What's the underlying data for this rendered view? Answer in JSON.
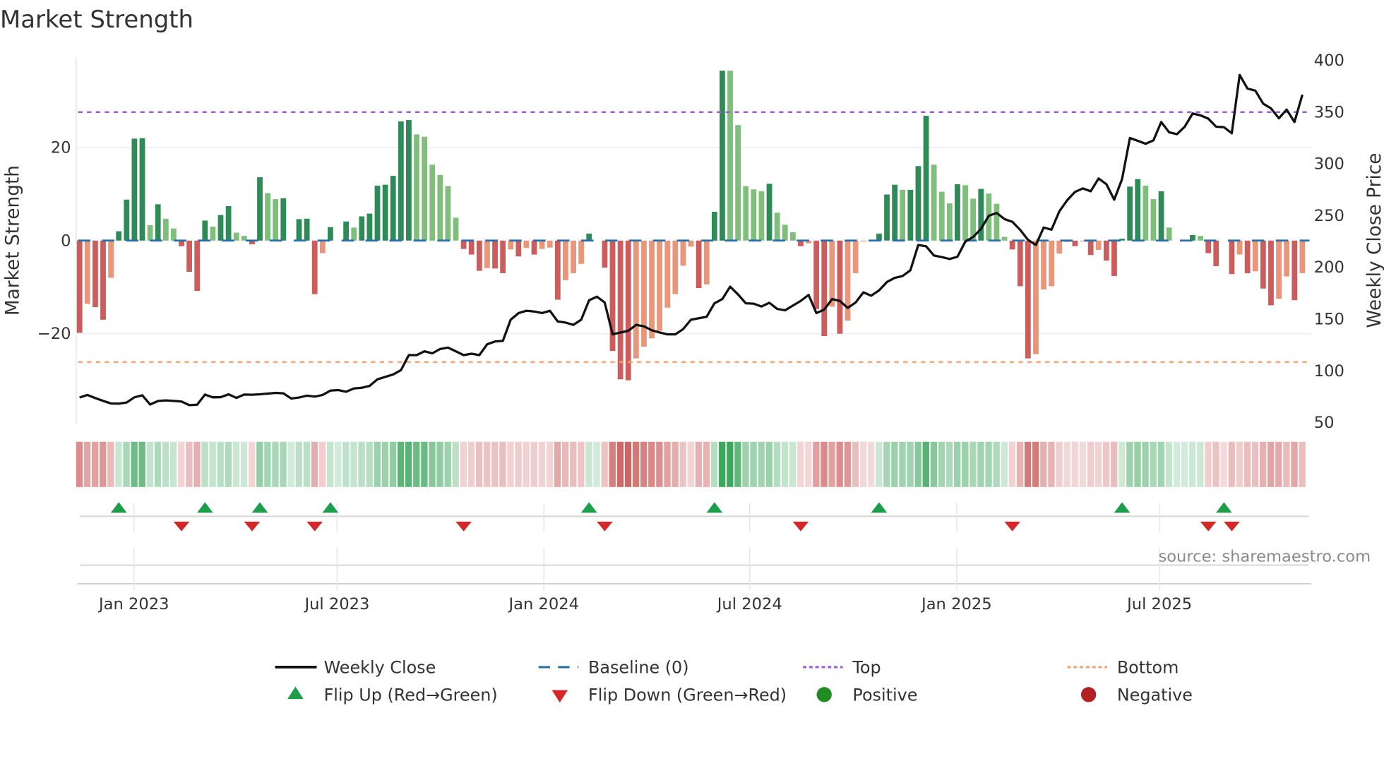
{
  "chart_data": {
    "type": "bar",
    "title": "Market Strength",
    "ylabel": "Market Strength",
    "ylabel_right": "Weekly Close Price",
    "source": "source: sharemaestro.com",
    "x_unit": "week index (weekly bars, ~Nov 2022 to Nov 2025)",
    "ylim": [
      -39.4,
      38.9
    ],
    "ylim_right": [
      47.7,
      400
    ],
    "y_left_ticks": [
      {
        "value": 20,
        "label": "20"
      },
      {
        "value": 0,
        "label": "0"
      },
      {
        "value": -20,
        "label": "−20"
      }
    ],
    "y_right_ticks": [
      {
        "value": 400,
        "label": "400"
      },
      {
        "value": 350,
        "label": "350"
      },
      {
        "value": 300,
        "label": "300"
      },
      {
        "value": 250,
        "label": "250"
      },
      {
        "value": 200,
        "label": "200"
      },
      {
        "value": 150,
        "label": "150"
      },
      {
        "value": 100,
        "label": "100"
      },
      {
        "value": 50,
        "label": "50"
      }
    ],
    "x_ticks": [
      {
        "week": 6.94,
        "label": "Jan 2023"
      },
      {
        "week": 32.86,
        "label": "Jul 2023"
      },
      {
        "week": 59.24,
        "label": "Jan 2024"
      },
      {
        "week": 85.5,
        "label": "Jul 2024"
      },
      {
        "week": 111.9,
        "label": "Jan 2025"
      },
      {
        "week": 137.78,
        "label": "Jul 2025"
      }
    ],
    "top_level": 27.6,
    "bottom_level": -26.1,
    "baseline": 0,
    "strength": [
      -19.8,
      -13.6,
      -14.3,
      -17,
      -8,
      2,
      8.8,
      21.9,
      22,
      3.3,
      7.8,
      4.7,
      2.6,
      -1.2,
      -6.7,
      -10.8,
      4.3,
      3,
      5.5,
      7.4,
      1.7,
      1,
      -0.8,
      13.6,
      10.2,
      8.9,
      9.1,
      0,
      4.6,
      4.7,
      -11.5,
      -2.7,
      2.9,
      0,
      4.1,
      2.8,
      5.2,
      5.8,
      11.8,
      12,
      13.9,
      25.6,
      25.9,
      22.8,
      22.3,
      16.3,
      14.1,
      11.7,
      4.9,
      -1.8,
      -3,
      -6.5,
      -5.9,
      -6,
      -7,
      -1.9,
      -3.4,
      -1.6,
      -3,
      -1.8,
      -1.5,
      -12.7,
      -8.5,
      -7,
      -5,
      1.5,
      0,
      -5.8,
      -23.7,
      -29.8,
      -30,
      -25.3,
      -22.8,
      -21,
      -19.4,
      -14.4,
      -11.5,
      -5.4,
      -1.3,
      -10.2,
      -9.4,
      6.2,
      36.5,
      36.5,
      24.8,
      11.7,
      11,
      10.6,
      12.2,
      6,
      3.4,
      1.8,
      -1.2,
      -0.6,
      -14.7,
      -20.5,
      -14.2,
      -20,
      -17.2,
      -7,
      -0.2,
      0,
      1.5,
      9.9,
      12,
      10.9,
      10.9,
      16,
      26.8,
      16.3,
      10.5,
      8,
      12.1,
      11.9,
      9,
      11.1,
      10.1,
      7.9,
      0.8,
      -1.9,
      -9.8,
      -25.3,
      -24.4,
      -10.5,
      -9.8,
      -2.8,
      -0.3,
      -1.2,
      -0.2,
      -3.1,
      -2,
      -4.3,
      -7.6,
      0.4,
      11.6,
      13.2,
      11.8,
      8.9,
      10.6,
      2.8,
      0,
      0,
      1.2,
      1,
      -2.7,
      -5.5,
      0,
      -7.2,
      -3,
      -7,
      -6.6,
      -10.3,
      -13.9,
      -12.5,
      -7.7,
      -12.8,
      -7
    ],
    "shade": "RrRRrGGGGgGggRRRGgGGggRGggGGGGRrGGGgGGGGGGGggggggRRRrRRrRrRrrRrrrGGRRRRrrrrrrrrRrGGgggggGgggRrRRrRrrrrGGGgGGGgggGggGgggRRRrrrrrRrRrRRGGGggGgggGgRRRRrRrRRrrRr",
    "weekly_close": [
      73.3,
      75.8,
      72.8,
      70.1,
      67.6,
      67.4,
      68.5,
      73.5,
      75.5,
      66.6,
      70,
      70.6,
      70.1,
      69.5,
      66,
      66.4,
      76.2,
      73.5,
      73.7,
      76.4,
      73,
      76.2,
      76,
      76.4,
      77.1,
      77.8,
      77.4,
      72.4,
      73.3,
      75.1,
      74.2,
      75.8,
      80,
      80.5,
      78.9,
      82.1,
      82.8,
      84.6,
      90.9,
      93.3,
      95.6,
      99.7,
      114.3,
      114.3,
      118,
      116,
      120.2,
      121.6,
      118,
      114.3,
      115.7,
      114.3,
      124.8,
      127.5,
      128,
      148.5,
      154.9,
      157.2,
      156.5,
      154.9,
      157.2,
      146.9,
      145.8,
      143.5,
      148.5,
      167.3,
      170.8,
      165.1,
      134.4,
      136.2,
      137.8,
      143.5,
      142.2,
      138.3,
      136.2,
      134.4,
      134.4,
      139.4,
      148.5,
      150,
      151.3,
      164.4,
      168.5,
      180.5,
      173,
      164.4,
      164,
      161.3,
      164.9,
      159,
      157.6,
      162.1,
      166.7,
      172.5,
      154.9,
      158.3,
      168.5,
      166.7,
      159.9,
      165.1,
      174.9,
      171.7,
      176.9,
      184.9,
      189,
      190.8,
      196.3,
      220.8,
      219.5,
      210.6,
      209,
      207.2,
      209.4,
      224,
      228.5,
      236.3,
      249,
      251.7,
      245.8,
      243.1,
      235.3,
      225.7,
      220.8,
      237.6,
      235.5,
      253.3,
      264,
      272,
      275.4,
      272.6,
      285,
      279.5,
      264.5,
      284.5,
      324.1,
      321.4,
      318.6,
      321.8,
      339.6,
      329.6,
      327.8,
      335,
      347.8,
      346,
      342.8,
      335,
      334.6,
      328.7,
      385.1,
      371.9,
      369.8,
      357.3,
      352.8,
      343.2,
      351.6,
      339.6,
      366
    ],
    "flip_up_weeks": [
      5,
      16,
      23,
      32,
      65,
      81,
      102,
      133,
      146
    ],
    "flip_down_weeks": [
      13,
      22,
      30,
      49,
      67,
      92,
      119,
      144,
      147
    ],
    "colors": {
      "dark_green": "#2e8b57",
      "light_green": "#7fbf7b",
      "dark_red": "#cd5c5c",
      "light_red": "#e9967a",
      "baseline": "#2a6fa8",
      "top": "#9b5fd6",
      "bottom": "#f0a470",
      "flip_up": "#1e9e4a",
      "flip_down": "#d62728",
      "positive": "#228b22",
      "negative": "#b22222",
      "close": "#111111"
    },
    "legend": {
      "weekly_close": "Weekly Close",
      "baseline": "Baseline (0)",
      "top": "Top",
      "bottom": "Bottom",
      "flip_up": "Flip Up (Red→Green)",
      "flip_down": "Flip Down (Green→Red)",
      "positive": "Positive",
      "negative": "Negative"
    }
  }
}
